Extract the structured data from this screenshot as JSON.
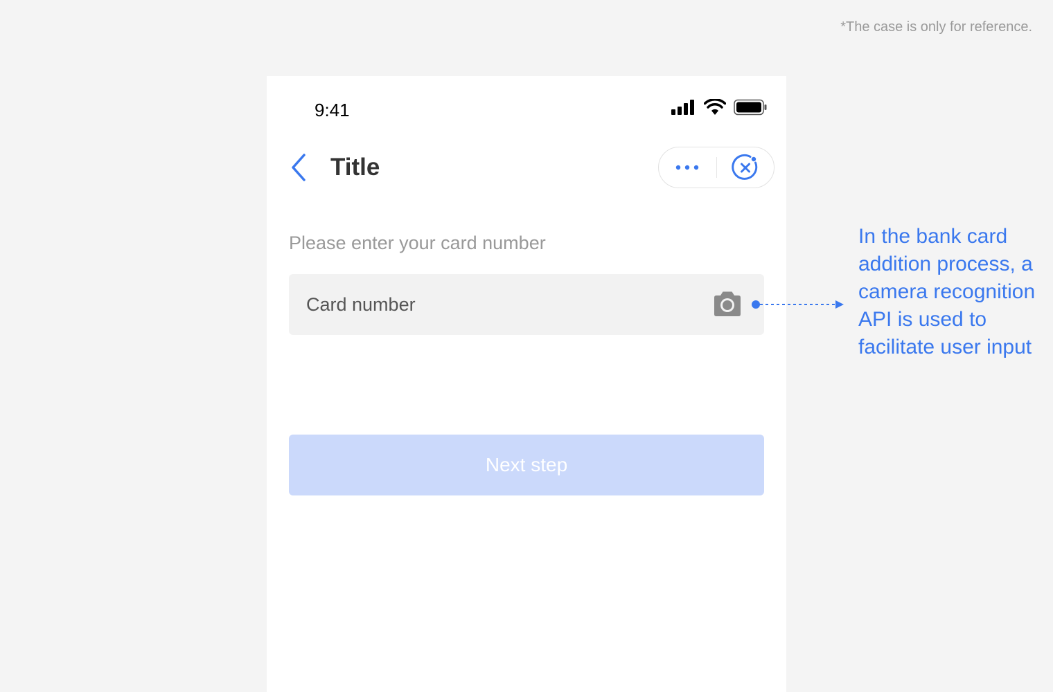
{
  "disclaimer": "*The case is only for reference.",
  "status_bar": {
    "time": "9:41",
    "icons": [
      "signal-icon",
      "wifi-icon",
      "battery-icon"
    ]
  },
  "nav": {
    "title": "Title",
    "back_icon": "back-chevron-icon",
    "more_icon": "more-dots-icon",
    "close_icon": "close-circle-icon"
  },
  "form": {
    "prompt": "Please enter your card number",
    "card_placeholder": "Card number",
    "camera_icon": "camera-icon",
    "next_label": "Next step"
  },
  "annotation": {
    "text": "In the bank card addition process, a camera recognition API is used to facilitate user input"
  },
  "colors": {
    "accent": "#3a78ee",
    "button_disabled": "#cbd9fb",
    "input_bg": "#f2f2f2",
    "page_bg": "#f4f4f4"
  }
}
